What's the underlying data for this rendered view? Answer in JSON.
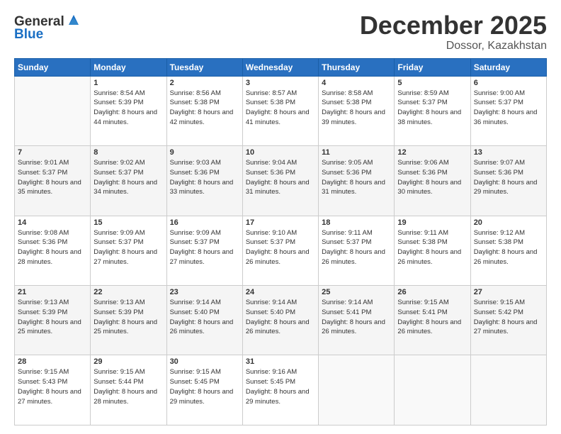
{
  "header": {
    "logo_line1": "General",
    "logo_line2": "Blue",
    "month_title": "December 2025",
    "location": "Dossor, Kazakhstan"
  },
  "weekdays": [
    "Sunday",
    "Monday",
    "Tuesday",
    "Wednesday",
    "Thursday",
    "Friday",
    "Saturday"
  ],
  "weeks": [
    [
      {
        "day": "",
        "sunrise": "",
        "sunset": "",
        "daylight": ""
      },
      {
        "day": "1",
        "sunrise": "Sunrise: 8:54 AM",
        "sunset": "Sunset: 5:39 PM",
        "daylight": "Daylight: 8 hours and 44 minutes."
      },
      {
        "day": "2",
        "sunrise": "Sunrise: 8:56 AM",
        "sunset": "Sunset: 5:38 PM",
        "daylight": "Daylight: 8 hours and 42 minutes."
      },
      {
        "day": "3",
        "sunrise": "Sunrise: 8:57 AM",
        "sunset": "Sunset: 5:38 PM",
        "daylight": "Daylight: 8 hours and 41 minutes."
      },
      {
        "day": "4",
        "sunrise": "Sunrise: 8:58 AM",
        "sunset": "Sunset: 5:38 PM",
        "daylight": "Daylight: 8 hours and 39 minutes."
      },
      {
        "day": "5",
        "sunrise": "Sunrise: 8:59 AM",
        "sunset": "Sunset: 5:37 PM",
        "daylight": "Daylight: 8 hours and 38 minutes."
      },
      {
        "day": "6",
        "sunrise": "Sunrise: 9:00 AM",
        "sunset": "Sunset: 5:37 PM",
        "daylight": "Daylight: 8 hours and 36 minutes."
      }
    ],
    [
      {
        "day": "7",
        "sunrise": "Sunrise: 9:01 AM",
        "sunset": "Sunset: 5:37 PM",
        "daylight": "Daylight: 8 hours and 35 minutes."
      },
      {
        "day": "8",
        "sunrise": "Sunrise: 9:02 AM",
        "sunset": "Sunset: 5:37 PM",
        "daylight": "Daylight: 8 hours and 34 minutes."
      },
      {
        "day": "9",
        "sunrise": "Sunrise: 9:03 AM",
        "sunset": "Sunset: 5:36 PM",
        "daylight": "Daylight: 8 hours and 33 minutes."
      },
      {
        "day": "10",
        "sunrise": "Sunrise: 9:04 AM",
        "sunset": "Sunset: 5:36 PM",
        "daylight": "Daylight: 8 hours and 31 minutes."
      },
      {
        "day": "11",
        "sunrise": "Sunrise: 9:05 AM",
        "sunset": "Sunset: 5:36 PM",
        "daylight": "Daylight: 8 hours and 31 minutes."
      },
      {
        "day": "12",
        "sunrise": "Sunrise: 9:06 AM",
        "sunset": "Sunset: 5:36 PM",
        "daylight": "Daylight: 8 hours and 30 minutes."
      },
      {
        "day": "13",
        "sunrise": "Sunrise: 9:07 AM",
        "sunset": "Sunset: 5:36 PM",
        "daylight": "Daylight: 8 hours and 29 minutes."
      }
    ],
    [
      {
        "day": "14",
        "sunrise": "Sunrise: 9:08 AM",
        "sunset": "Sunset: 5:36 PM",
        "daylight": "Daylight: 8 hours and 28 minutes."
      },
      {
        "day": "15",
        "sunrise": "Sunrise: 9:09 AM",
        "sunset": "Sunset: 5:37 PM",
        "daylight": "Daylight: 8 hours and 27 minutes."
      },
      {
        "day": "16",
        "sunrise": "Sunrise: 9:09 AM",
        "sunset": "Sunset: 5:37 PM",
        "daylight": "Daylight: 8 hours and 27 minutes."
      },
      {
        "day": "17",
        "sunrise": "Sunrise: 9:10 AM",
        "sunset": "Sunset: 5:37 PM",
        "daylight": "Daylight: 8 hours and 26 minutes."
      },
      {
        "day": "18",
        "sunrise": "Sunrise: 9:11 AM",
        "sunset": "Sunset: 5:37 PM",
        "daylight": "Daylight: 8 hours and 26 minutes."
      },
      {
        "day": "19",
        "sunrise": "Sunrise: 9:11 AM",
        "sunset": "Sunset: 5:38 PM",
        "daylight": "Daylight: 8 hours and 26 minutes."
      },
      {
        "day": "20",
        "sunrise": "Sunrise: 9:12 AM",
        "sunset": "Sunset: 5:38 PM",
        "daylight": "Daylight: 8 hours and 26 minutes."
      }
    ],
    [
      {
        "day": "21",
        "sunrise": "Sunrise: 9:13 AM",
        "sunset": "Sunset: 5:39 PM",
        "daylight": "Daylight: 8 hours and 25 minutes."
      },
      {
        "day": "22",
        "sunrise": "Sunrise: 9:13 AM",
        "sunset": "Sunset: 5:39 PM",
        "daylight": "Daylight: 8 hours and 25 minutes."
      },
      {
        "day": "23",
        "sunrise": "Sunrise: 9:14 AM",
        "sunset": "Sunset: 5:40 PM",
        "daylight": "Daylight: 8 hours and 26 minutes."
      },
      {
        "day": "24",
        "sunrise": "Sunrise: 9:14 AM",
        "sunset": "Sunset: 5:40 PM",
        "daylight": "Daylight: 8 hours and 26 minutes."
      },
      {
        "day": "25",
        "sunrise": "Sunrise: 9:14 AM",
        "sunset": "Sunset: 5:41 PM",
        "daylight": "Daylight: 8 hours and 26 minutes."
      },
      {
        "day": "26",
        "sunrise": "Sunrise: 9:15 AM",
        "sunset": "Sunset: 5:41 PM",
        "daylight": "Daylight: 8 hours and 26 minutes."
      },
      {
        "day": "27",
        "sunrise": "Sunrise: 9:15 AM",
        "sunset": "Sunset: 5:42 PM",
        "daylight": "Daylight: 8 hours and 27 minutes."
      }
    ],
    [
      {
        "day": "28",
        "sunrise": "Sunrise: 9:15 AM",
        "sunset": "Sunset: 5:43 PM",
        "daylight": "Daylight: 8 hours and 27 minutes."
      },
      {
        "day": "29",
        "sunrise": "Sunrise: 9:15 AM",
        "sunset": "Sunset: 5:44 PM",
        "daylight": "Daylight: 8 hours and 28 minutes."
      },
      {
        "day": "30",
        "sunrise": "Sunrise: 9:15 AM",
        "sunset": "Sunset: 5:45 PM",
        "daylight": "Daylight: 8 hours and 29 minutes."
      },
      {
        "day": "31",
        "sunrise": "Sunrise: 9:16 AM",
        "sunset": "Sunset: 5:45 PM",
        "daylight": "Daylight: 8 hours and 29 minutes."
      },
      {
        "day": "",
        "sunrise": "",
        "sunset": "",
        "daylight": ""
      },
      {
        "day": "",
        "sunrise": "",
        "sunset": "",
        "daylight": ""
      },
      {
        "day": "",
        "sunrise": "",
        "sunset": "",
        "daylight": ""
      }
    ]
  ]
}
